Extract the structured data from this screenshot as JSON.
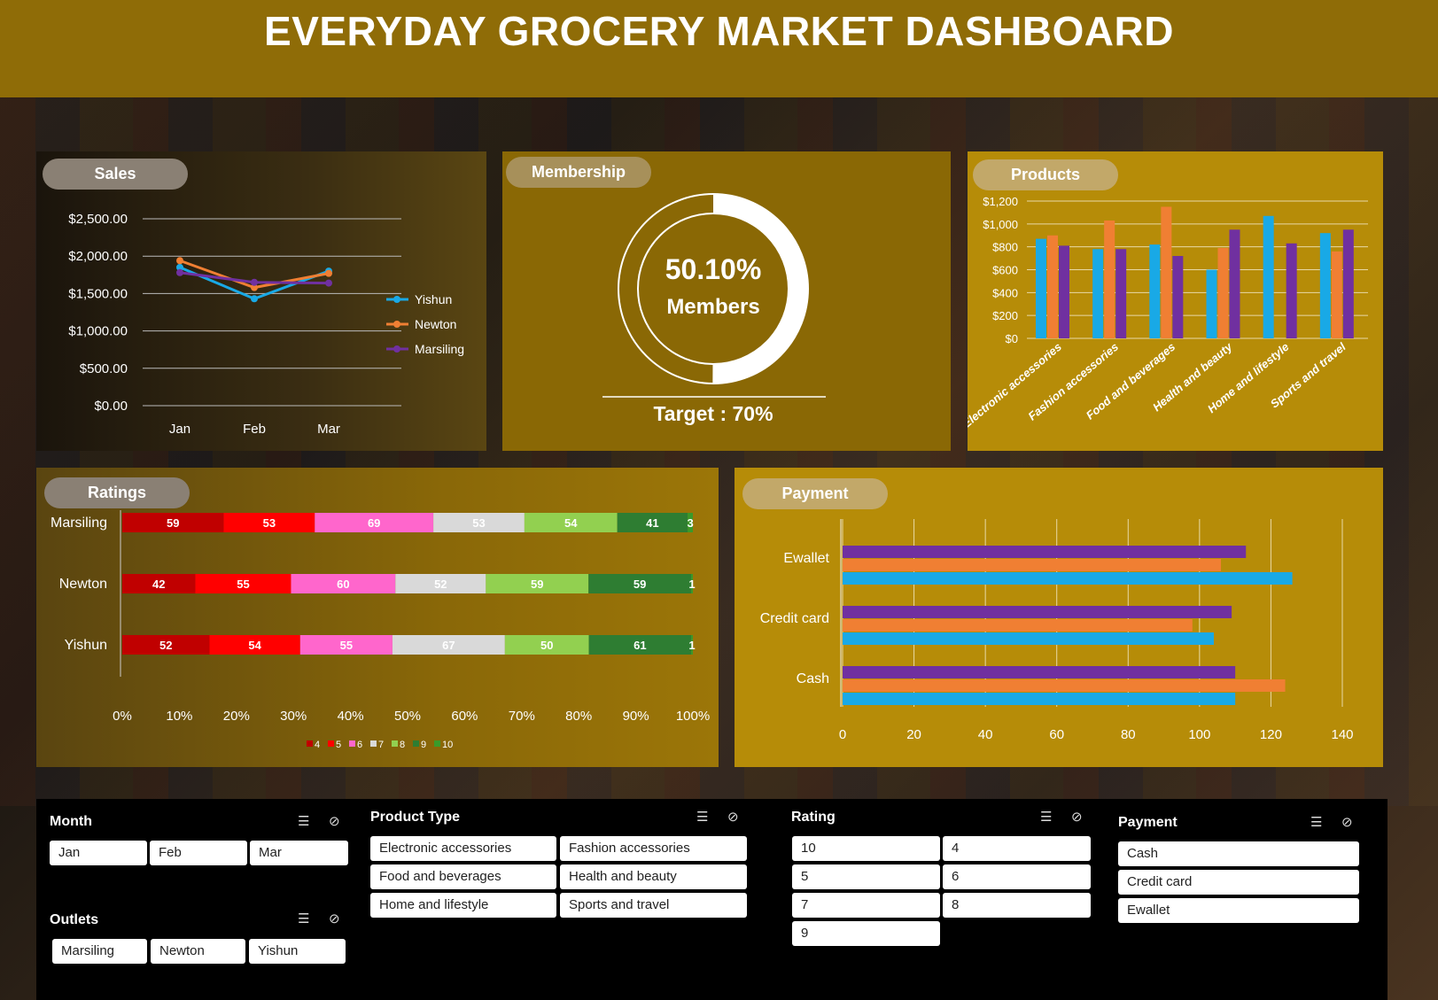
{
  "title": "EVERYDAY GROCERY MARKET DASHBOARD",
  "colors": {
    "yishun": "#19a9e6",
    "newton": "#f07f33",
    "marsiling": "#7030a0",
    "header": "#8f6c07"
  },
  "sales": {
    "label": "Sales",
    "chart_data": {
      "type": "line",
      "categories": [
        "Jan",
        "Feb",
        "Mar"
      ],
      "series": [
        {
          "name": "Yishun",
          "values": [
            1850,
            1430,
            1800
          ]
        },
        {
          "name": "Newton",
          "values": [
            1940,
            1580,
            1770
          ]
        },
        {
          "name": "Marsiling",
          "values": [
            1780,
            1650,
            1640
          ]
        }
      ],
      "ylim": [
        0,
        2500
      ],
      "yticks": [
        "$0.00",
        "$500.00",
        "$1,000.00",
        "$1,500.00",
        "$2,000.00",
        "$2,500.00"
      ],
      "legend": "right"
    }
  },
  "membership": {
    "label": "Membership",
    "value_text": "50.10%",
    "value": 50.1,
    "sub": "Members",
    "target": "Target : 70%"
  },
  "products": {
    "label": "Products",
    "chart_data": {
      "type": "bar",
      "categories": [
        "Electronic accessories",
        "Fashion accessories",
        "Food and beverages",
        "Health and beauty",
        "Home and lifestyle",
        "Sports and travel"
      ],
      "series": [
        {
          "name": "Yishun",
          "values": [
            870,
            780,
            820,
            600,
            1070,
            920
          ]
        },
        {
          "name": "Newton",
          "values": [
            900,
            1030,
            1150,
            790,
            0,
            760
          ]
        },
        {
          "name": "Marsiling",
          "values": [
            810,
            780,
            720,
            950,
            830,
            950
          ]
        }
      ],
      "ylim": [
        0,
        1200
      ],
      "yticks": [
        "$0",
        "$200",
        "$400",
        "$600",
        "$800",
        "$1,000",
        "$1,200"
      ]
    }
  },
  "ratings": {
    "label": "Ratings",
    "chart_data": {
      "type": "bar",
      "categories": [
        "Marsiling",
        "Newton",
        "Yishun"
      ],
      "segment_names": [
        "4",
        "5",
        "6",
        "7",
        "8",
        "9",
        "10"
      ],
      "segment_colors": [
        "#c00000",
        "#ff0000",
        "#ff66cc",
        "#d9d9d9",
        "#92d050",
        "#2e7d32",
        "#3a9a2a"
      ],
      "rows": [
        [
          59,
          53,
          69,
          53,
          54,
          41,
          3
        ],
        [
          42,
          55,
          60,
          52,
          59,
          59,
          1
        ],
        [
          52,
          54,
          55,
          67,
          50,
          61,
          1
        ]
      ],
      "xticks": [
        "0%",
        "10%",
        "20%",
        "30%",
        "40%",
        "50%",
        "60%",
        "70%",
        "80%",
        "90%",
        "100%"
      ]
    }
  },
  "payment": {
    "label": "Payment",
    "chart_data": {
      "type": "bar",
      "categories": [
        "Ewallet",
        "Credit card",
        "Cash"
      ],
      "series": [
        {
          "name": "Marsiling",
          "values": [
            113,
            109,
            110
          ]
        },
        {
          "name": "Newton",
          "values": [
            106,
            98,
            124
          ]
        },
        {
          "name": "Yishun",
          "values": [
            126,
            104,
            110
          ]
        }
      ],
      "xlim": [
        0,
        140
      ],
      "xticks": [
        "0",
        "20",
        "40",
        "60",
        "80",
        "100",
        "120",
        "140"
      ]
    }
  },
  "slicers": {
    "month": {
      "title": "Month",
      "items": [
        "Jan",
        "Feb",
        "Mar"
      ]
    },
    "outlets": {
      "title": "Outlets",
      "items": [
        "Marsiling",
        "Newton",
        "Yishun"
      ]
    },
    "product_type": {
      "title": "Product Type",
      "items": [
        "Electronic accessories",
        "Fashion accessories",
        "Food and beverages",
        "Health and beauty",
        "Home and lifestyle",
        "Sports and travel"
      ]
    },
    "rating": {
      "title": "Rating",
      "items": [
        "10",
        "4",
        "5",
        "6",
        "7",
        "8",
        "9"
      ]
    },
    "payment": {
      "title": "Payment",
      "items": [
        "Cash",
        "Credit card",
        "Ewallet"
      ]
    }
  }
}
